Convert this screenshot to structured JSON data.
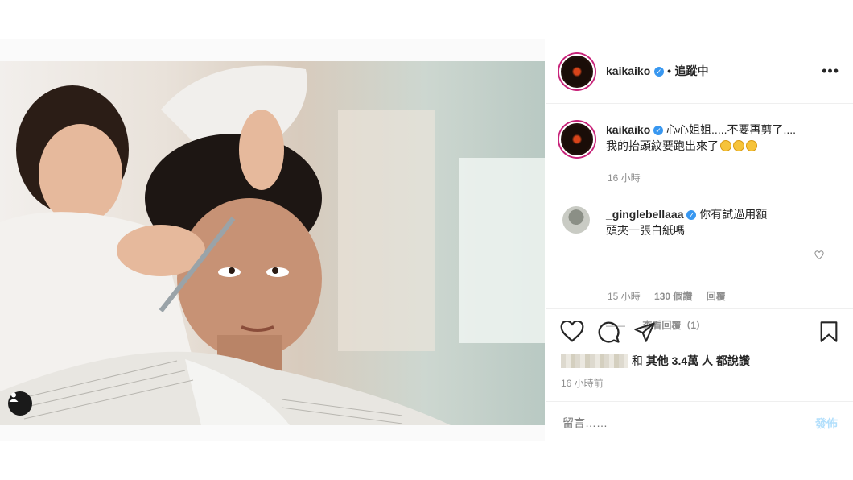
{
  "post": {
    "author": "kaikaiko",
    "verified": true,
    "separator": "•",
    "follow_status": "追蹤中",
    "more": "•••"
  },
  "caption": {
    "user": "kaikaiko",
    "text_line1": "心心姐姐.....不要再剪了....",
    "text_line2": "我的抬頭紋要跑出來了",
    "time": "16 小時"
  },
  "comments": [
    {
      "user": "_ginglebellaaa",
      "text_line1": "你有試過用額",
      "text_line2": "頭夾一張白紙嗎",
      "time": "15 小時",
      "likes": "130 個讚",
      "reply_label": "回覆",
      "view_replies": "查看回覆（1）",
      "view_replies_dash": "——"
    }
  ],
  "likes": {
    "text_and": "和",
    "text_others": "其他 3.4萬 人",
    "text_suffix": "都說讚",
    "time_ago": "16 小時前"
  },
  "add_comment": {
    "placeholder": "留言……",
    "post_button": "發佈"
  },
  "icons": [
    "heart-icon",
    "comment-icon",
    "share-icon",
    "bookmark-icon",
    "user-tag-icon",
    "heart-small-icon"
  ]
}
